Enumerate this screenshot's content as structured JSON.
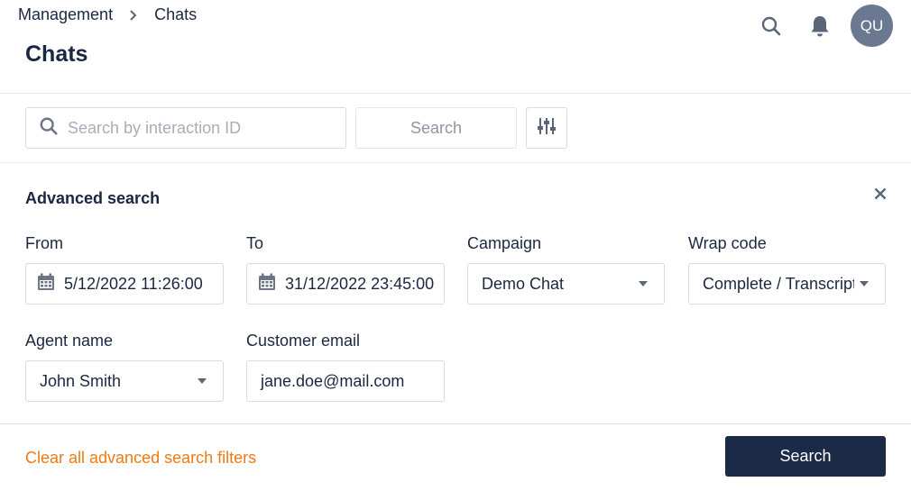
{
  "breadcrumb": {
    "items": [
      "Management",
      "Chats"
    ]
  },
  "header": {
    "title": "Chats",
    "avatar_initials": "QU"
  },
  "quick_search": {
    "placeholder": "Search by interaction ID",
    "value": "",
    "button_label": "Search"
  },
  "advanced_search": {
    "title": "Advanced search",
    "from": {
      "label": "From",
      "value": "5/12/2022 11:26:00"
    },
    "to": {
      "label": "To",
      "value": "31/12/2022 23:45:00"
    },
    "campaign": {
      "label": "Campaign",
      "value": "Demo Chat"
    },
    "wrap_code": {
      "label": "Wrap code",
      "value": "Complete / Transcript"
    },
    "agent_name": {
      "label": "Agent name",
      "value": "John Smith"
    },
    "customer_email": {
      "label": "Customer email",
      "value": "jane.doe@mail.com"
    }
  },
  "footer": {
    "clear_label": "Clear all advanced search filters",
    "search_label": "Search"
  },
  "colors": {
    "primary": "#1b2a47",
    "accent": "#f07b14",
    "avatar_bg": "#6a7891",
    "border": "#d8dbe0"
  }
}
